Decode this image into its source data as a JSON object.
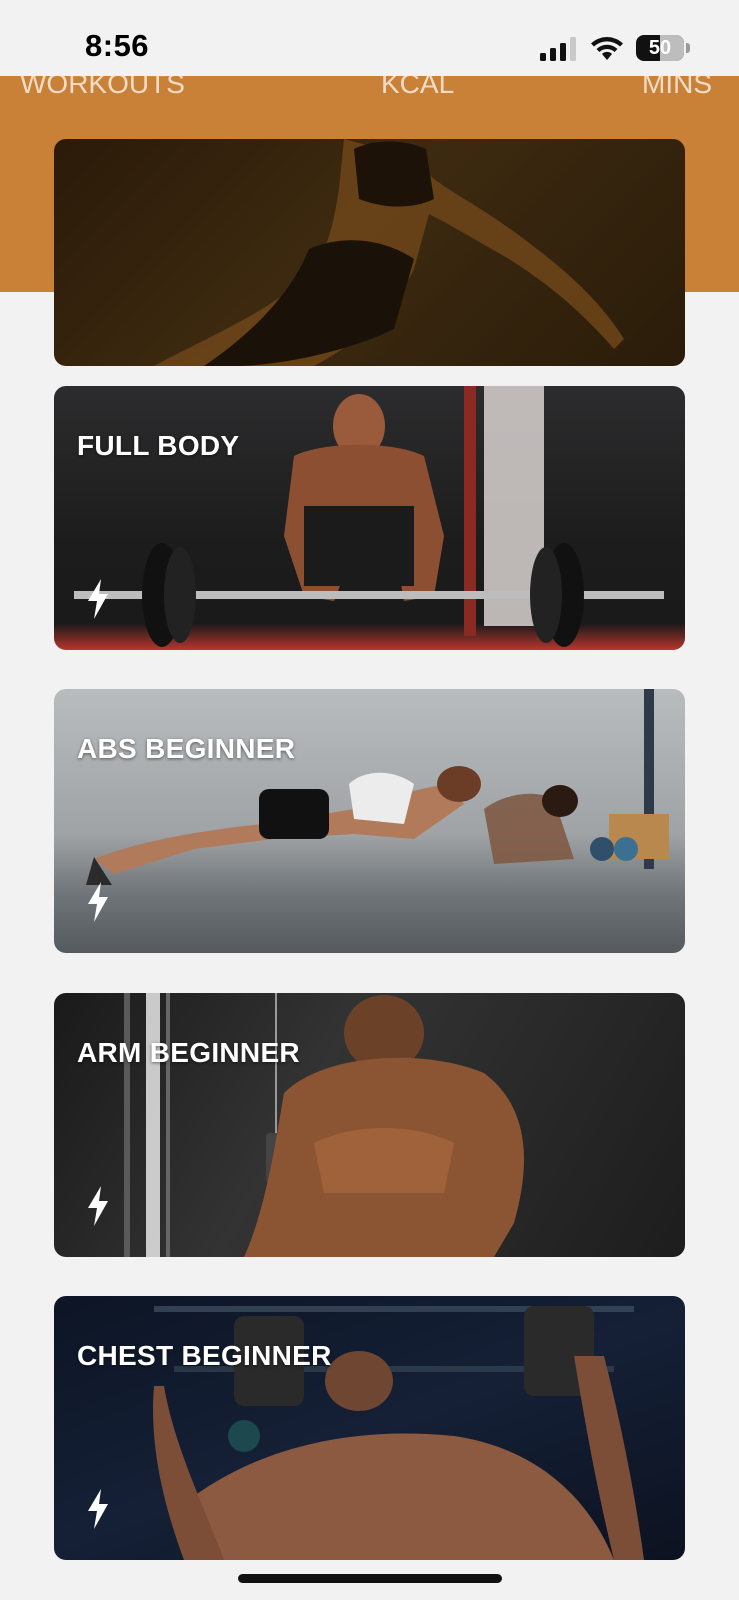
{
  "status_bar": {
    "time": "8:56",
    "battery_level": "50",
    "signal_icon": "cellular-signal-icon",
    "wifi_icon": "wifi-icon",
    "battery_icon": "battery-icon"
  },
  "stats_banner": {
    "color": "#c98137",
    "labels": [
      "WORKOUTS",
      "KCAL",
      "MINS"
    ]
  },
  "workouts": [
    {
      "title": "FULL BODY",
      "icon": "lightning-bolt-icon"
    },
    {
      "title": "ABS BEGINNER",
      "icon": "lightning-bolt-icon"
    },
    {
      "title": "ARM BEGINNER",
      "icon": "lightning-bolt-icon"
    },
    {
      "title": "CHEST BEGINNER",
      "icon": "lightning-bolt-icon"
    }
  ]
}
